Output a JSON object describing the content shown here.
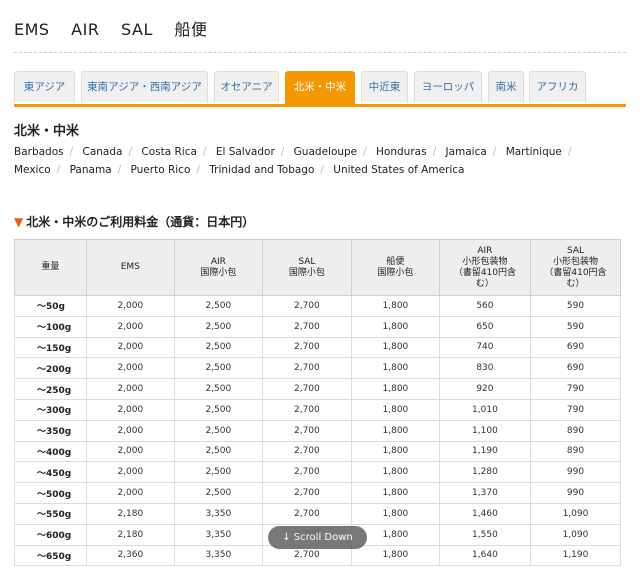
{
  "header": {
    "services": [
      "EMS",
      "AIR",
      "SAL",
      "船便"
    ]
  },
  "tabs": [
    {
      "label": "東アジア",
      "active": false
    },
    {
      "label": "東南アジア・西南アジア",
      "active": false
    },
    {
      "label": "オセアニア",
      "active": false
    },
    {
      "label": "北米・中米",
      "active": true
    },
    {
      "label": "中近東",
      "active": false
    },
    {
      "label": "ヨーロッパ",
      "active": false
    },
    {
      "label": "南米",
      "active": false
    },
    {
      "label": "アフリカ",
      "active": false
    }
  ],
  "region": {
    "title": "北米・中米",
    "countries": [
      "Barbados",
      "Canada",
      "Costa Rica",
      "El Salvador",
      "Guadeloupe",
      "Honduras",
      "Jamaica",
      "Martinique",
      "Mexico",
      "Panama",
      "Puerto Rico",
      "Trinidad and Tobago",
      "United States of America"
    ]
  },
  "rates": {
    "title": "北米・中米のご利用料金（通貨：日本円）",
    "headers": [
      [
        "重量"
      ],
      [
        "EMS"
      ],
      [
        "AIR",
        "国際小包"
      ],
      [
        "SAL",
        "国際小包"
      ],
      [
        "船便",
        "国際小包"
      ],
      [
        "AIR",
        "小形包装物",
        "（書留410円含",
        "む）"
      ],
      [
        "SAL",
        "小形包装物",
        "（書留410円含",
        "む）"
      ]
    ],
    "rows": [
      [
        "〜50g",
        "2,000",
        "2,500",
        "2,700",
        "1,800",
        "560",
        "590"
      ],
      [
        "〜100g",
        "2,000",
        "2,500",
        "2,700",
        "1,800",
        "650",
        "590"
      ],
      [
        "〜150g",
        "2,000",
        "2,500",
        "2,700",
        "1,800",
        "740",
        "690"
      ],
      [
        "〜200g",
        "2,000",
        "2,500",
        "2,700",
        "1,800",
        "830",
        "690"
      ],
      [
        "〜250g",
        "2,000",
        "2,500",
        "2,700",
        "1,800",
        "920",
        "790"
      ],
      [
        "〜300g",
        "2,000",
        "2,500",
        "2,700",
        "1,800",
        "1,010",
        "790"
      ],
      [
        "〜350g",
        "2,000",
        "2,500",
        "2,700",
        "1,800",
        "1,100",
        "890"
      ],
      [
        "〜400g",
        "2,000",
        "2,500",
        "2,700",
        "1,800",
        "1,190",
        "890"
      ],
      [
        "〜450g",
        "2,000",
        "2,500",
        "2,700",
        "1,800",
        "1,280",
        "990"
      ],
      [
        "〜500g",
        "2,000",
        "2,500",
        "2,700",
        "1,800",
        "1,370",
        "990"
      ],
      [
        "〜550g",
        "2,180",
        "3,350",
        "2,700",
        "1,800",
        "1,460",
        "1,090"
      ],
      [
        "〜600g",
        "2,180",
        "3,350",
        "2,700",
        "1,800",
        "1,550",
        "1,090"
      ],
      [
        "〜650g",
        "2,360",
        "3,350",
        "2,700",
        "1,800",
        "1,640",
        "1,190"
      ]
    ]
  },
  "scroll": {
    "label": "↓ Scroll Down"
  },
  "colors": {
    "accent": "#f39800",
    "tab_text": "#3a6ea5",
    "marker": "#e8600e"
  }
}
